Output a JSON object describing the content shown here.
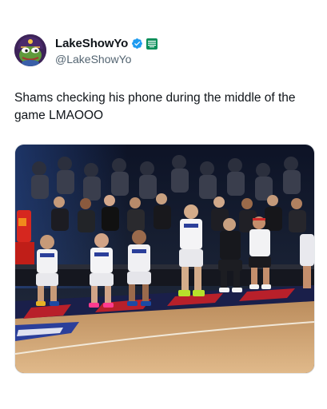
{
  "tweet": {
    "display_name": "LakeShowYo",
    "handle": "@LakeShowYo",
    "text": "Shams checking his phone during the middle of the game LMAOOO",
    "avatar_icon": "pepe-frog-lakers-avatar",
    "verified_icon": "verified-check-icon",
    "affiliate_icon": "affiliate-badge-icon",
    "colors": {
      "verified": "#1d9bf0",
      "affiliate": "#0a8f5a",
      "handle": "#536471",
      "text": "#0f1419"
    }
  },
  "media": {
    "type": "video-still",
    "description_icon": "basketball-court-sideline-photo"
  }
}
